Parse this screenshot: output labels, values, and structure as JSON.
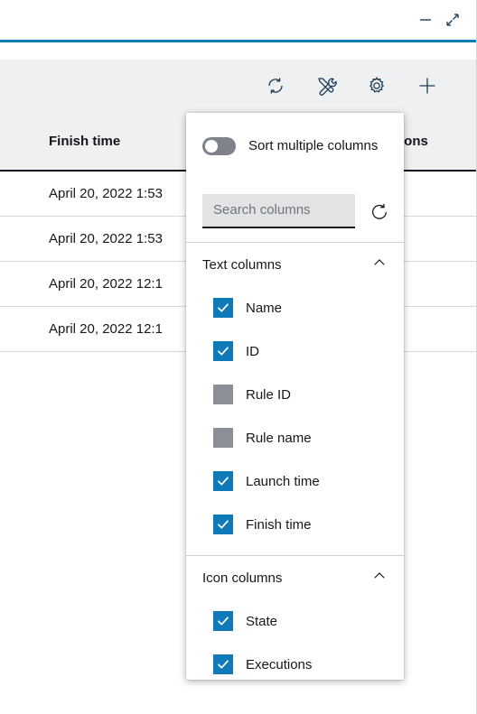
{
  "window": {
    "minimize_icon": "minimize-icon",
    "maximize_icon": "maximize-restore-icon",
    "accent_color": "#0f7ab8"
  },
  "toolbar": {
    "buttons": [
      {
        "name": "refresh-button",
        "icon": "refresh-icon"
      },
      {
        "name": "tools-button",
        "icon": "tools-icon"
      },
      {
        "name": "settings-button",
        "icon": "gear-icon"
      },
      {
        "name": "add-button",
        "icon": "plus-icon"
      }
    ]
  },
  "table": {
    "columns": [
      {
        "key": "finish_time",
        "label": "Finish time"
      },
      {
        "key": "executions",
        "label": "tions"
      }
    ],
    "rows": [
      {
        "finish_time": "April 20, 2022 1:53"
      },
      {
        "finish_time": "April 20, 2022 1:53"
      },
      {
        "finish_time": "April 20, 2022 12:1"
      },
      {
        "finish_time": "April 20, 2022 12:1"
      }
    ]
  },
  "popup": {
    "sort_toggle": {
      "label": "Sort multiple columns",
      "enabled": false
    },
    "search": {
      "placeholder": "Search columns",
      "value": ""
    },
    "reset_icon": "reset-icon",
    "groups": [
      {
        "title": "Text columns",
        "expanded": true,
        "options": [
          {
            "label": "Name",
            "checked": true
          },
          {
            "label": "ID",
            "checked": true
          },
          {
            "label": "Rule ID",
            "checked": false
          },
          {
            "label": "Rule name",
            "checked": false
          },
          {
            "label": "Launch time",
            "checked": true
          },
          {
            "label": "Finish time",
            "checked": true
          }
        ]
      },
      {
        "title": "Icon columns",
        "expanded": true,
        "options": [
          {
            "label": "State",
            "checked": true
          },
          {
            "label": "Executions",
            "checked": true
          }
        ]
      }
    ]
  }
}
